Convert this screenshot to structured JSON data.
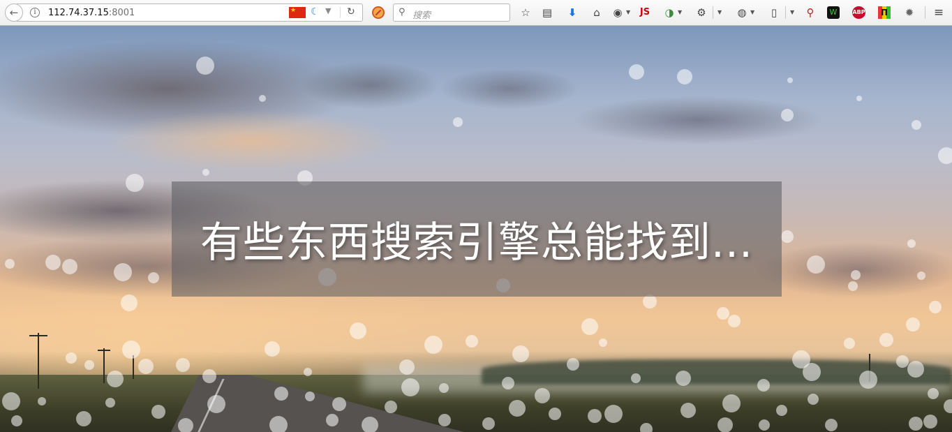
{
  "toolbar": {
    "back_icon": "back-arrow-icon",
    "url_host": "112.74.37.15",
    "url_port": ":8001",
    "search_placeholder": "搜索",
    "js_label": "JS",
    "abp_label": "ABP",
    "flag_label": "★",
    "icons": [
      "info-icon",
      "china-flag-icon",
      "swirl-icon",
      "dropdown-icon",
      "reload-icon",
      "blocked-extension-icon",
      "search-icon",
      "bookmark-star-icon",
      "reading-list-icon",
      "download-icon",
      "home-icon",
      "globe-icon",
      "javascript-toggle-icon",
      "translate-icon",
      "palette-icon",
      "chrome-icon",
      "page-info-icon",
      "magnifier-extension-icon",
      "shield-icon",
      "adblock-icon",
      "plugin-icon",
      "settings-gear-icon",
      "hamburger-menu-icon"
    ],
    "accent_download": "#1a73e8",
    "accent_js": "#d40000",
    "accent_abp": "#c70d2c"
  },
  "page": {
    "headline": "有些东西搜索引擎总能找到..."
  }
}
